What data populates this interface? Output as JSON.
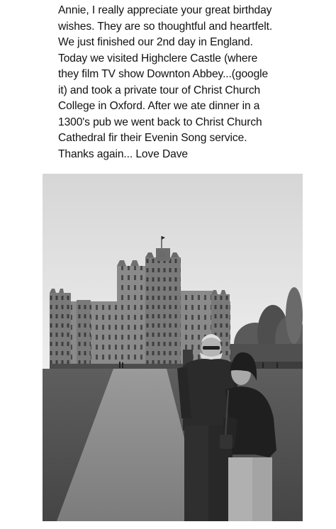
{
  "message": {
    "lines": [
      "Annie, I really appreciate your great birthday",
      "wishes. They are so thoughtful and heartfelt.",
      "We just finished our 2nd day in England.",
      "Today we visited Highclere Castle (where",
      "they film TV show Downton Abbey...(google",
      "it) and took a private tour of Christ Church",
      "College in Oxford. After we ate dinner in a",
      "1300's pub we went back to Christ Church",
      "Cathedral fir their Evenin Song service.",
      "Thanks again... Love Dave"
    ]
  },
  "photo": {
    "style": "black-and-white",
    "subject": "castle-with-couple"
  }
}
